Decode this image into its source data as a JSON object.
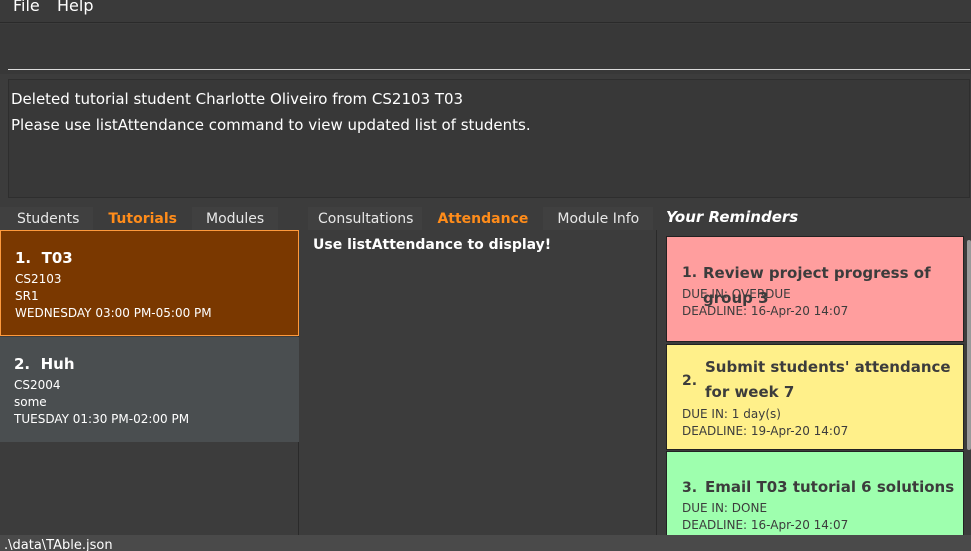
{
  "menubar": {
    "file": "File",
    "help": "Help"
  },
  "command": {
    "value": "",
    "placeholder": ""
  },
  "result": {
    "line1": "Deleted tutorial student Charlotte Oliveiro from CS2103 T03",
    "line2": "Please use listAttendance command to view updated list of students."
  },
  "left_tabs": {
    "students": "Students",
    "tutorials": "Tutorials",
    "modules": "Modules",
    "active": "Tutorials"
  },
  "tutorials": [
    {
      "index": "1.",
      "name": "T03",
      "module": "CS2103",
      "venue": "SR1",
      "time": "WEDNESDAY 03:00 PM-05:00 PM"
    },
    {
      "index": "2.",
      "name": "Huh",
      "module": "CS2004",
      "venue": "some",
      "time": "TUESDAY 01:30 PM-02:00 PM"
    }
  ],
  "mid_tabs": {
    "consultations": "Consultations",
    "attendance": "Attendance",
    "module_info": "Module Info",
    "active": "Attendance"
  },
  "attendance_message": "Use listAttendance to display!",
  "reminders": {
    "title": "Your Reminders",
    "items": [
      {
        "index": "1.",
        "description": "Review project progress of group 3",
        "due": "DUE IN: OVERDUE",
        "deadline": "DEADLINE: 16-Apr-20 14:07",
        "color": "#ff9e9e"
      },
      {
        "index": "2.",
        "description": "Submit students' attendance for week 7",
        "due": "DUE IN: 1 day(s)",
        "deadline": "DEADLINE: 19-Apr-20 14:07",
        "color": "#fff08a"
      },
      {
        "index": "3.",
        "description": "Email T03 tutorial 6 solutions",
        "due": "DUE IN: DONE",
        "deadline": "DEADLINE: 16-Apr-20 14:07",
        "color": "#9effae"
      }
    ]
  },
  "statusbar": {
    "path": ".\\data\\TAble.json"
  }
}
